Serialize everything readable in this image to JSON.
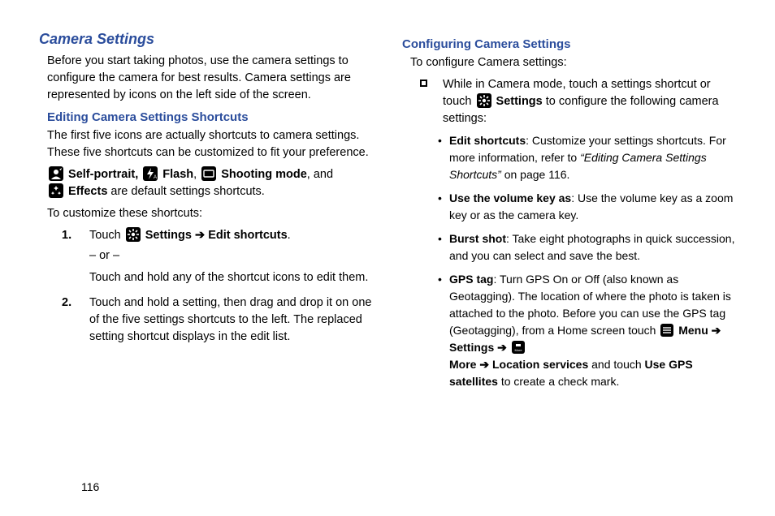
{
  "left": {
    "h_section": "Camera Settings",
    "intro": "Before you start taking photos, use the camera settings to configure the camera for best results. Camera settings are represented by icons on the left side of the screen.",
    "h_sub": "Editing Camera Settings Shortcuts",
    "p2": "The first five icons are actually shortcuts to camera settings. These five shortcuts can be customized to fit your preference.",
    "defaults": {
      "self_portrait": "Self-portrait,",
      "flash": "Flash",
      "shooting_mode": "Shooting mode",
      "and": ", and",
      "effects": "Effects",
      "tail": " are default settings shortcuts."
    },
    "p_customize": "To customize these shortcuts:",
    "step1": {
      "num": "1.",
      "touch": "Touch ",
      "settings": "Settings",
      "arrow": " ➔ ",
      "edit": "Edit shortcuts",
      "period": ".",
      "or": "– or –",
      "alt": "Touch and hold any of the shortcut icons to edit them."
    },
    "step2": {
      "num": "2.",
      "text": "Touch and hold a setting, then drag and drop it on one of the five settings shortcuts to the left. The replaced setting shortcut displays in the edit list."
    }
  },
  "right": {
    "h_sub": "Configuring Camera Settings",
    "intro": "To configure Camera settings:",
    "sq1": {
      "pre": "While in Camera mode, touch a settings shortcut or touch ",
      "settings": "Settings",
      "post": " to configure the following camera settings:"
    },
    "b1": {
      "title": "Edit shortcuts",
      "a": ": Customize your settings shortcuts. For more information, refer to ",
      "ref_i": "“Editing Camera Settings Shortcuts”",
      "b": "  on page 116."
    },
    "b2": {
      "title": "Use the volume key as",
      "text": ": Use the volume key as a zoom key or as the camera key."
    },
    "b3": {
      "title": "Burst shot",
      "text": ": Take eight photographs in quick succession, and you can select and save the best."
    },
    "b4": {
      "title": "GPS tag",
      "a": ": Turn GPS On or Off (also known as Geotagging). The location of where the photo is taken is attached to the photo. Before you can use the GPS tag (Geotagging), from a Home screen touch ",
      "menu": "Menu",
      "arr": " ➔ ",
      "settings": "Settings",
      "more": "More ",
      "loc": "Location services",
      "and": " and touch ",
      "gps": "Use GPS satellites",
      "tail": " to create a check mark."
    }
  },
  "page_num": "116",
  "icons": {
    "self_portrait": "self-portrait-icon",
    "flash": "flash-icon",
    "shooting_mode": "shooting-mode-icon",
    "effects": "effects-icon",
    "settings": "settings-gear-icon",
    "menu": "menu-icon",
    "more": "more-icon"
  }
}
